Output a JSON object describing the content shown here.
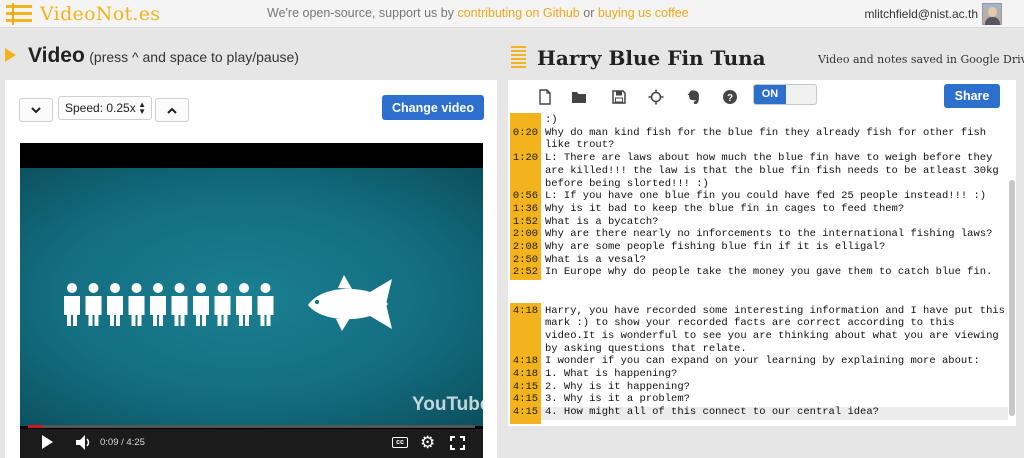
{
  "app": {
    "logo_text": "VideoNot.es",
    "promo_prefix": "We're open-source, support us by ",
    "promo_link_github": "contributing on Github",
    "promo_or": " or ",
    "promo_link_coffee": "buying us coffee",
    "user_email": "mlitchfield@nist.ac.th"
  },
  "video_panel": {
    "heading_main": "Video",
    "heading_hint": "(press ^ and space to play/pause)",
    "speed_label": "Speed: 0.25x",
    "change_video_label": "Change video",
    "player": {
      "time_display": "0:09 / 4:25",
      "progress_fraction": 0.034,
      "watermark": "YouTube",
      "cc_label": "cc",
      "person_count": 10
    }
  },
  "notes_panel": {
    "title": "Harry Blue Fin Tuna",
    "saved_status": "Video and notes saved in Google Drive",
    "toggle_label": "ON",
    "share_label": "Share",
    "toolbar_icons": [
      "new-file-icon",
      "open-folder-icon",
      "save-icon",
      "sync-target-icon",
      "evernote-icon",
      "help-icon"
    ],
    "notes": [
      {
        "time": "",
        "text": ":)"
      },
      {
        "time": "0:20",
        "text": "Why do man kind fish for the blue fin they already fish for other fish like trout?"
      },
      {
        "time": "1:20",
        "text": "L: There are laws about how much the blue fin have to weigh before they are killed!!! the law is that the blue fin fish needs to be atleast 30kg before being slorted!!!        :)"
      },
      {
        "time": "0:56",
        "text": "L: If you have one blue fin you could have fed 25 people instead!!!   :)"
      },
      {
        "time": "1:36",
        "text": "Why is it bad to keep the blue fin in cages to feed them?"
      },
      {
        "time": "1:52",
        "text": "What is a bycatch?"
      },
      {
        "time": "2:00",
        "text": "Why are there nearly no inforcements to the international fishing laws?"
      },
      {
        "time": "2:08",
        "text": "Why are some people fishing blue fin if it is elligal?"
      },
      {
        "time": "2:50",
        "text": "What is a vesal?"
      },
      {
        "time": "2:52",
        "text": "In Europe why do people take the money you gave them to catch blue fin."
      },
      {
        "time": "4:18",
        "text": "Harry, you have recorded some interesting information and I have put this mark :) to show your recorded facts are correct according to this video.It is wonderful to see you are thinking about what you are viewing by asking questions that relate."
      },
      {
        "time": "4:18",
        "text": "I wonder if you can expand on your learning by explaining more about:"
      },
      {
        "time": "4:18",
        "text": "1. What is happening?"
      },
      {
        "time": "4:15",
        "text": "2. Why is it happening?"
      },
      {
        "time": "4:15",
        "text": "3. Why is it a problem?"
      },
      {
        "time": "4:15",
        "text": "4. How might all of this connect to our central idea?"
      }
    ]
  },
  "colors": {
    "accent_yellow": "#f2b31c",
    "button_blue": "#2d6fcc",
    "video_teal": "#136e80",
    "progress_red": "#cc181e"
  }
}
